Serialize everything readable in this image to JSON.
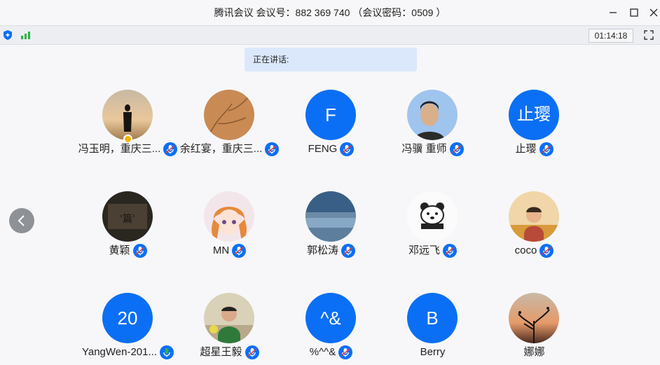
{
  "window": {
    "title": "腾讯会议 会议号：882 369 740 （会议密码：0509 ）"
  },
  "toolbar": {
    "timer": "01:14:18",
    "icons": [
      "shield-icon",
      "signal-icon",
      "fullscreen-icon"
    ]
  },
  "speaking": {
    "label": "正在讲话:"
  },
  "colors": {
    "accent": "#0b6ff5",
    "mic_active": "#2cb34a",
    "host_badge": "#f5b400"
  },
  "participants": [
    {
      "name": "冯玉明，重庆三...",
      "avatar": "photo-silhouette",
      "mic": "muted",
      "host": true
    },
    {
      "name": "余红宴，重庆三...",
      "avatar": "photo-texture",
      "mic": "muted"
    },
    {
      "name": "FENG",
      "avatar_text": "F",
      "mic": "muted"
    },
    {
      "name": "冯骥 重师",
      "avatar": "photo-person",
      "mic": "muted"
    },
    {
      "name": "止璎",
      "avatar_text": "止璎",
      "mic": "muted"
    },
    {
      "name": "黄颖",
      "avatar": "photo-calligraphy",
      "mic": "muted"
    },
    {
      "name": "MN",
      "avatar": "photo-anime",
      "mic": "muted"
    },
    {
      "name": "郭松涛",
      "avatar": "photo-lake",
      "mic": "muted"
    },
    {
      "name": "邓远飞",
      "avatar": "photo-bear",
      "mic": "muted"
    },
    {
      "name": "coco",
      "avatar": "photo-child",
      "mic": "muted"
    },
    {
      "name": "YangWen-201...",
      "avatar_text": "20",
      "mic": "active"
    },
    {
      "name": "超星王毅",
      "avatar": "photo-person-2",
      "mic": "muted"
    },
    {
      "name": "%^^&",
      "avatar_text": "^&",
      "mic": "muted"
    },
    {
      "name": "Berry",
      "avatar_text": "B",
      "mic": "none"
    },
    {
      "name": "娜娜",
      "avatar": "photo-sunset",
      "mic": "none"
    }
  ]
}
